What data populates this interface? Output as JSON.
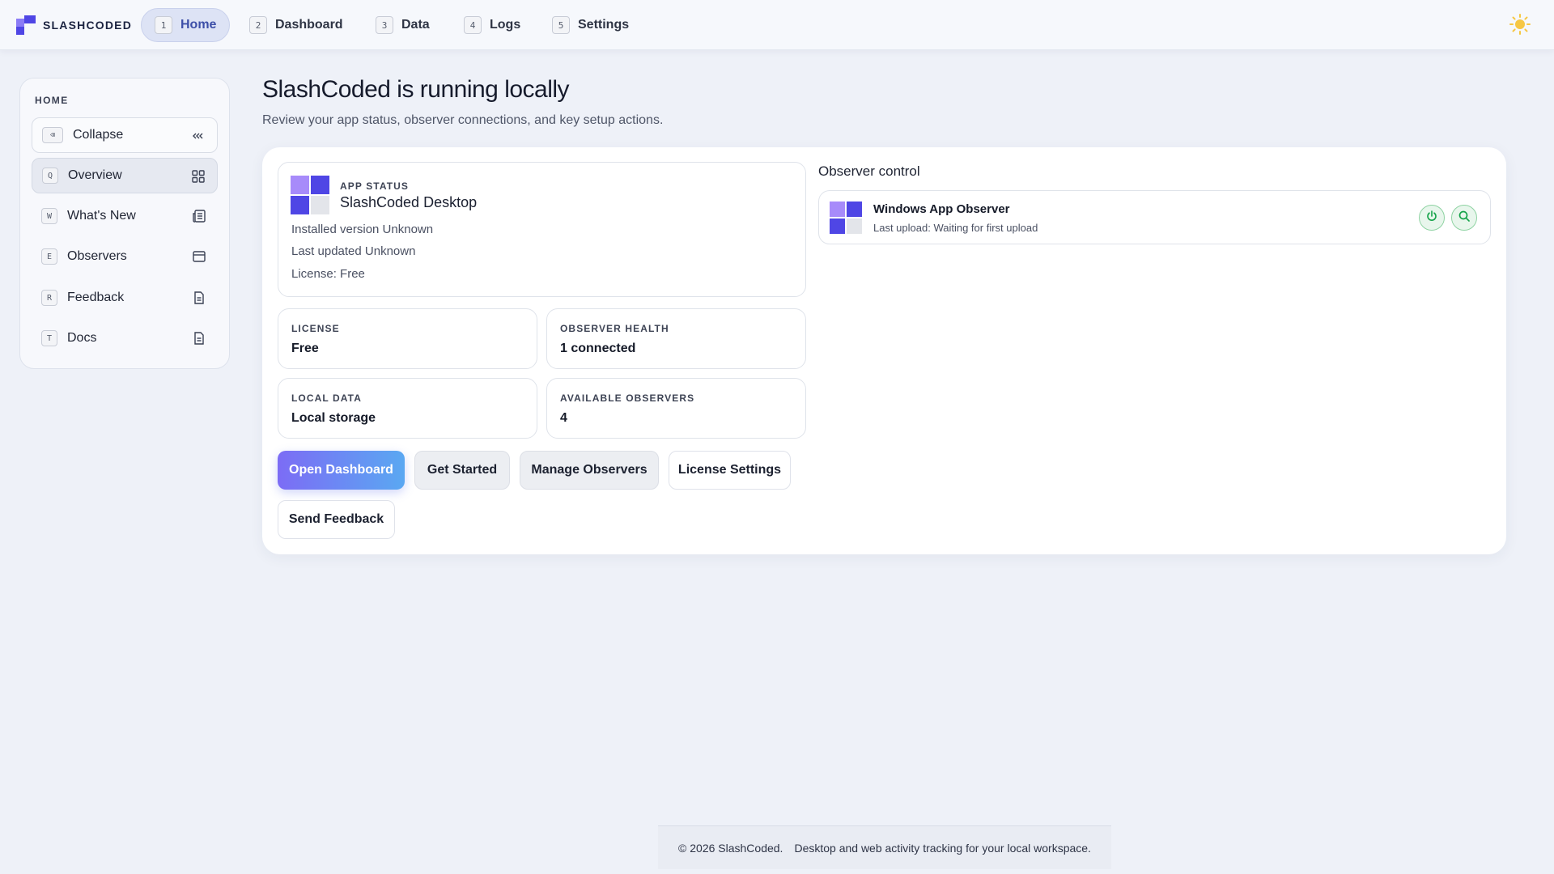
{
  "brand": {
    "name": "SLASHCODED"
  },
  "nav": {
    "tabs": [
      {
        "key": "1",
        "label": "Home",
        "active": true
      },
      {
        "key": "2",
        "label": "Dashboard"
      },
      {
        "key": "3",
        "label": "Data"
      },
      {
        "key": "4",
        "label": "Logs"
      },
      {
        "key": "5",
        "label": "Settings"
      }
    ],
    "theme_icon": "sun-icon"
  },
  "sidebar": {
    "heading": "HOME",
    "items": [
      {
        "key": "⌫",
        "label": "Collapse",
        "icon": "chevrons-left-icon"
      },
      {
        "key": "Q",
        "label": "Overview",
        "icon": "grid-icon"
      },
      {
        "key": "W",
        "label": "What's New",
        "icon": "newspaper-icon"
      },
      {
        "key": "E",
        "label": "Observers",
        "icon": "window-icon"
      },
      {
        "key": "R",
        "label": "Feedback",
        "icon": "document-icon"
      },
      {
        "key": "T",
        "label": "Docs",
        "icon": "document-icon"
      }
    ]
  },
  "main": {
    "title": "SlashCoded is running locally",
    "subtitle": "Review your app status, observer connections, and key setup actions.",
    "app_status": {
      "label": "APP STATUS",
      "name": "SlashCoded Desktop",
      "installed": "Installed version Unknown",
      "updated": "Last updated Unknown",
      "license": "License: Free"
    },
    "stats": [
      {
        "label": "LICENSE",
        "value": "Free"
      },
      {
        "label": "OBSERVER HEALTH",
        "value": "1 connected"
      },
      {
        "label": "LOCAL DATA",
        "value": "Local storage"
      },
      {
        "label": "AVAILABLE OBSERVERS",
        "value": "4"
      }
    ],
    "buttons": {
      "open_dashboard": "Open Dashboard",
      "get_started": "Get Started",
      "manage_observers": "Manage Observers",
      "license_settings": "License Settings",
      "send_feedback": "Send Feedback"
    },
    "observer": {
      "heading": "Observer control",
      "name": "Windows App Observer",
      "last_upload": "Last upload: Waiting for first upload",
      "power_icon": "power-icon",
      "search_icon": "search-icon"
    }
  },
  "footer": {
    "copyright": "© 2026 SlashCoded.",
    "tagline": "Desktop and web activity tracking for your local workspace."
  },
  "colors": {
    "accent": "#4f46e5",
    "accent_light": "#a78bfa",
    "status_green": "#16a34a"
  }
}
